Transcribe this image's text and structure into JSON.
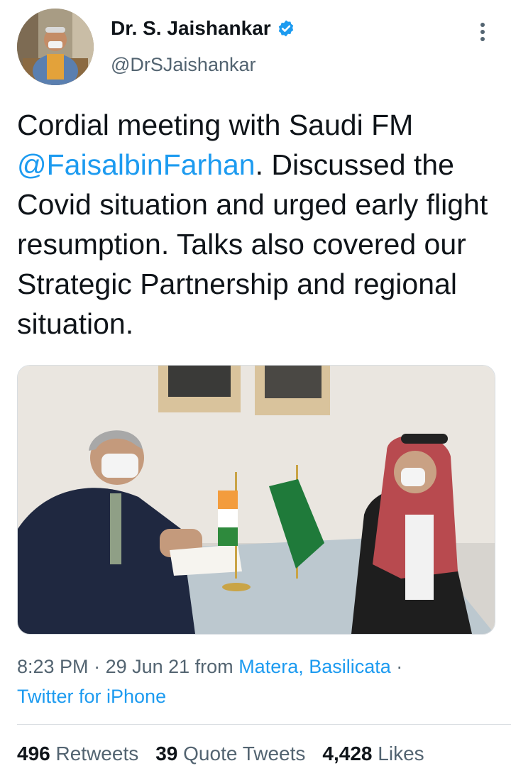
{
  "author": {
    "name": "Dr. S. Jaishankar",
    "handle": "@DrSJaishankar"
  },
  "tweet": {
    "text_before": "Cordial meeting with Saudi FM ",
    "mention": "@FaisalbinFarhan",
    "text_after": ". Discussed the Covid situation and urged early flight resumption. Talks also covered our Strategic Partnership and regional situation."
  },
  "meta": {
    "time": "8:23 PM",
    "sep1": " · ",
    "date": "29 Jun 21",
    "from": " from ",
    "location": "Matera, Basilicata",
    "sep2": " ·",
    "client": "Twitter for iPhone"
  },
  "stats": {
    "retweets_count": "496",
    "retweets_label": "Retweets",
    "quotes_count": "39",
    "quotes_label": "Quote Tweets",
    "likes_count": "4,428",
    "likes_label": "Likes"
  },
  "colors": {
    "link": "#1d9bf0",
    "secondary_text": "#536471",
    "primary_text": "#0f1419",
    "verified_badge": "#1d9bf0"
  },
  "icons": [
    "verified-badge-icon",
    "more-options-icon"
  ]
}
